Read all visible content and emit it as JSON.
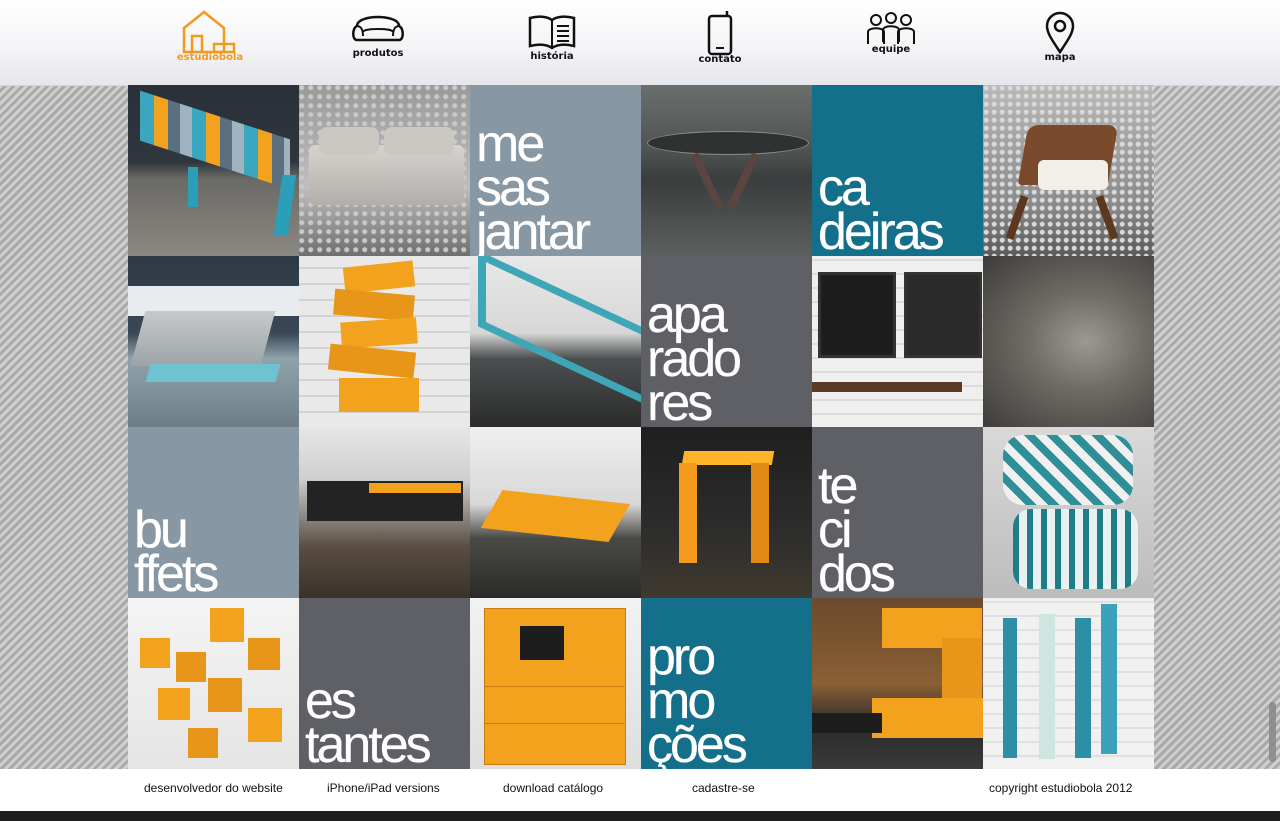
{
  "nav": {
    "logo_label": "estudiobola",
    "items": [
      {
        "label": "produtos",
        "icon": "sofa-icon"
      },
      {
        "label": "história",
        "icon": "book-icon"
      },
      {
        "label": "contato",
        "icon": "phone-icon"
      },
      {
        "label": "equipe",
        "icon": "people-icon"
      },
      {
        "label": "mapa",
        "icon": "map-pin-icon"
      }
    ]
  },
  "categories": {
    "mesas_jantar": "me\nsas\njantar",
    "cadeiras": "ca\ndeiras",
    "aparadores": "apa\nrado\nres",
    "buffets": "bu\nffets",
    "tecidos": "te\nci\ndos",
    "estantes": "es\ntantes",
    "promocoes": "pro\nmo\nções"
  },
  "footer": {
    "developer": "desenvolvedor do website",
    "iphone": "iPhone/iPad versions",
    "catalog": "download catálogo",
    "signup": "cadastre-se",
    "copyright": "copyright estudiobola 2012"
  },
  "colors": {
    "accent_orange": "#f39a1d",
    "teal": "#136f8a",
    "slate_blue_grey": "#8797a3",
    "dark_grey": "#5f6066"
  }
}
